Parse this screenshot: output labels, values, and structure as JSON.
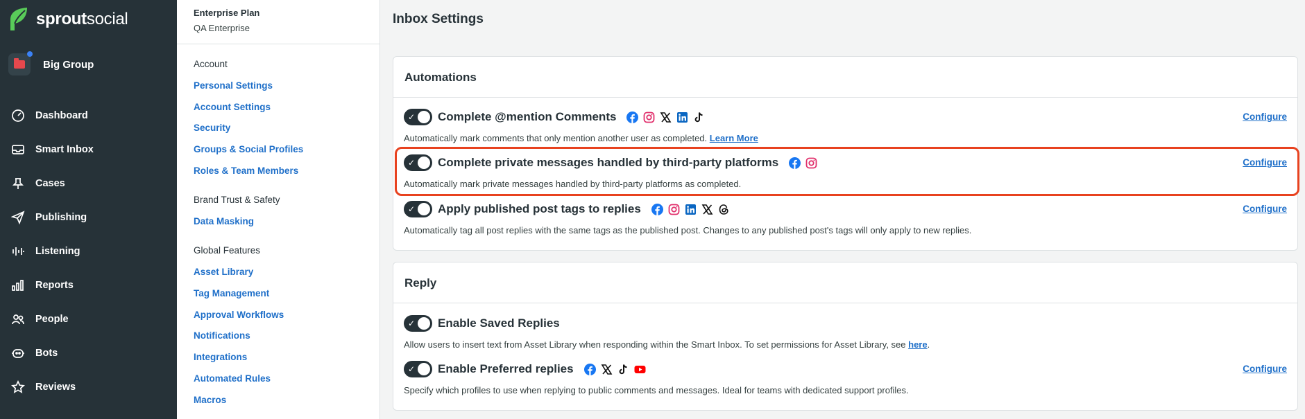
{
  "brand": {
    "name_bold": "sprout",
    "name_light": "social"
  },
  "group": {
    "label": "Big Group"
  },
  "nav": {
    "items": [
      {
        "label": "Dashboard",
        "icon": "dashboard-icon"
      },
      {
        "label": "Smart Inbox",
        "icon": "inbox-icon"
      },
      {
        "label": "Cases",
        "icon": "pin-icon"
      },
      {
        "label": "Publishing",
        "icon": "paper-plane-icon"
      },
      {
        "label": "Listening",
        "icon": "waveform-icon"
      },
      {
        "label": "Reports",
        "icon": "bar-chart-icon"
      },
      {
        "label": "People",
        "icon": "people-icon"
      },
      {
        "label": "Bots",
        "icon": "bot-icon"
      },
      {
        "label": "Reviews",
        "icon": "star-icon"
      }
    ]
  },
  "subnav": {
    "plan_title": "Enterprise Plan",
    "plan_sub": "QA Enterprise",
    "account_head": "Account",
    "personal_settings": "Personal Settings",
    "account_settings": "Account Settings",
    "security": "Security",
    "groups_profiles": "Groups & Social Profiles",
    "roles_team": "Roles & Team Members",
    "brand_head": "Brand Trust & Safety",
    "data_masking": "Data Masking",
    "global_head": "Global Features",
    "asset_library": "Asset Library",
    "tag_management": "Tag Management",
    "approval_workflows": "Approval Workflows",
    "notifications": "Notifications",
    "integrations": "Integrations",
    "automated_rules": "Automated Rules",
    "macros": "Macros"
  },
  "main": {
    "title": "Inbox Settings",
    "automations": {
      "title": "Automations",
      "mention": {
        "title": "Complete @mention Comments",
        "desc": "Automatically mark comments that only mention another user as completed.",
        "link": "Learn More",
        "configure": "Configure"
      },
      "private": {
        "title": "Complete private messages handled by third-party platforms",
        "desc": "Automatically mark private messages handled by third-party platforms as completed.",
        "configure": "Configure"
      },
      "tags": {
        "title": "Apply published post tags to replies",
        "desc": "Automatically tag all post replies with the same tags as the published post. Changes to any published post's tags will only apply to new replies.",
        "configure": "Configure"
      }
    },
    "reply": {
      "title": "Reply",
      "saved": {
        "title": "Enable Saved Replies",
        "desc": "Allow users to insert text from Asset Library when responding within the Smart Inbox. To set permissions for Asset Library, see",
        "link": "here",
        "suffix": "."
      },
      "preferred": {
        "title": "Enable Preferred replies",
        "desc": "Specify which profiles to use when replying to public comments and messages. Ideal for teams with dedicated support profiles.",
        "configure": "Configure"
      }
    }
  },
  "colors": {
    "nav_bg": "#263238",
    "link": "#2070c9",
    "highlight": "#e8421f",
    "brand_green": "#59cb59",
    "facebook": "#1877f2",
    "instagram": "#e1306c",
    "linkedin": "#0a66c2",
    "youtube": "#ff0000"
  }
}
